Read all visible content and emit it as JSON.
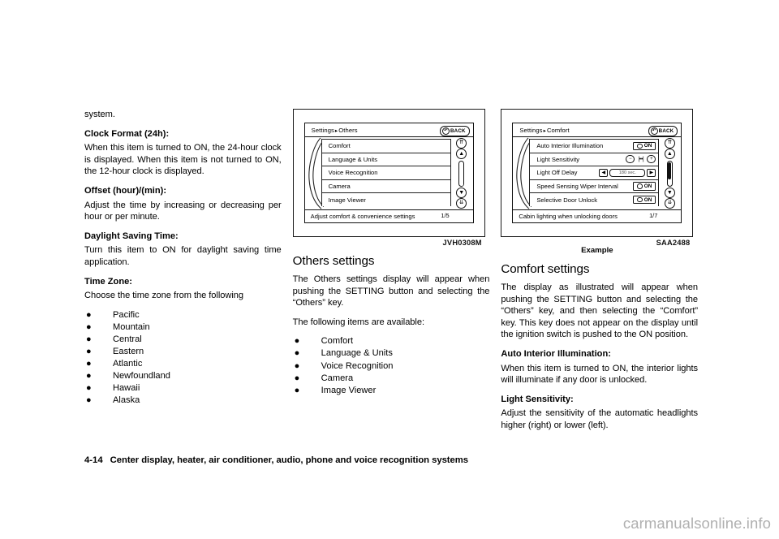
{
  "column1": {
    "intro_fragment": "system.",
    "blocks": [
      {
        "heading": "Clock Format (24h):",
        "body": "When this item is turned to ON, the 24-hour clock is displayed. When this item is not turned to ON, the 12-hour clock is displayed."
      },
      {
        "heading": "Offset (hour)/(min):",
        "body": "Adjust the time by increasing or decreasing per hour or per minute."
      },
      {
        "heading": "Daylight Saving Time:",
        "body": "Turn this item to ON for daylight saving time application."
      },
      {
        "heading": "Time Zone:",
        "body": "Choose the time zone from the following"
      }
    ],
    "time_zones": [
      "Pacific",
      "Mountain",
      "Central",
      "Eastern",
      "Atlantic",
      "Newfoundland",
      "Hawaii",
      "Alaska"
    ],
    "bullet_glyph": "●"
  },
  "figure1": {
    "caption": "JVH0308M",
    "screen": {
      "breadcrumb_root": "Settings",
      "breadcrumb_arrow": "▸",
      "breadcrumb_leaf": "Others",
      "back_label": "BACK",
      "back_icon": "↶",
      "rows": [
        {
          "label": "Comfort"
        },
        {
          "label": "Language & Units"
        },
        {
          "label": "Voice Recognition"
        },
        {
          "label": "Camera"
        },
        {
          "label": "Image Viewer"
        }
      ],
      "page_indicator": "1/5",
      "status_text": "Adjust comfort & convenience settings",
      "scroll": {
        "top_fast": "⇈",
        "up": "▲",
        "down": "▼",
        "bottom_fast": "⇊"
      }
    }
  },
  "figure2": {
    "caption": "SAA2488",
    "subcaption": "Example",
    "screen": {
      "breadcrumb_root": "Settings",
      "breadcrumb_arrow": "▸",
      "breadcrumb_leaf": "Comfort",
      "back_label": "BACK",
      "back_icon": "↶",
      "rows": [
        {
          "label": "Auto Interior Illumination",
          "control": "on",
          "value": "ON"
        },
        {
          "label": "Light Sensitivity",
          "control": "stepper",
          "minus": "−",
          "gauge": "|••|",
          "plus": "+"
        },
        {
          "label": "Light Off Delay",
          "control": "spinner",
          "left": "◀",
          "value": "180 sec.",
          "right": "▶"
        },
        {
          "label": "Speed Sensing Wiper Interval",
          "control": "on",
          "value": "ON"
        },
        {
          "label": "Selective Door Unlock",
          "control": "on",
          "value": "ON"
        }
      ],
      "page_indicator": "1/7",
      "status_text": "Cabin lighting when unlocking doors",
      "scroll": {
        "top_fast": "⇈",
        "up": "▲",
        "down": "▼",
        "bottom_fast": "⇊"
      }
    }
  },
  "column2": {
    "section_title": "Others settings",
    "paragraph1": "The Others settings display will appear when pushing the SETTING button and selecting the “Others” key.",
    "paragraph2": "The following items are available:",
    "items": [
      "Comfort",
      "Language & Units",
      "Voice Recognition",
      "Camera",
      "Image Viewer"
    ],
    "bullet_glyph": "●"
  },
  "column3": {
    "section_title": "Comfort settings",
    "paragraph1": "The display as illustrated will appear when pushing the SETTING button and selecting the “Others” key, and then selecting the “Comfort” key. This key does not appear on the display until the ignition switch is pushed to the ON position.",
    "blocks": [
      {
        "heading": "Auto Interior Illumination:",
        "body": "When this item is turned to ON, the interior lights will illuminate if any door is unlocked."
      },
      {
        "heading": "Light Sensitivity:",
        "body": "Adjust the sensitivity of the automatic headlights higher (right) or lower (left)."
      }
    ]
  },
  "footer": {
    "page_number": "4-14",
    "chapter_title": "Center display, heater, air conditioner, audio, phone and voice recognition systems"
  },
  "watermark": {
    "text": "carmanualsonline.info"
  }
}
